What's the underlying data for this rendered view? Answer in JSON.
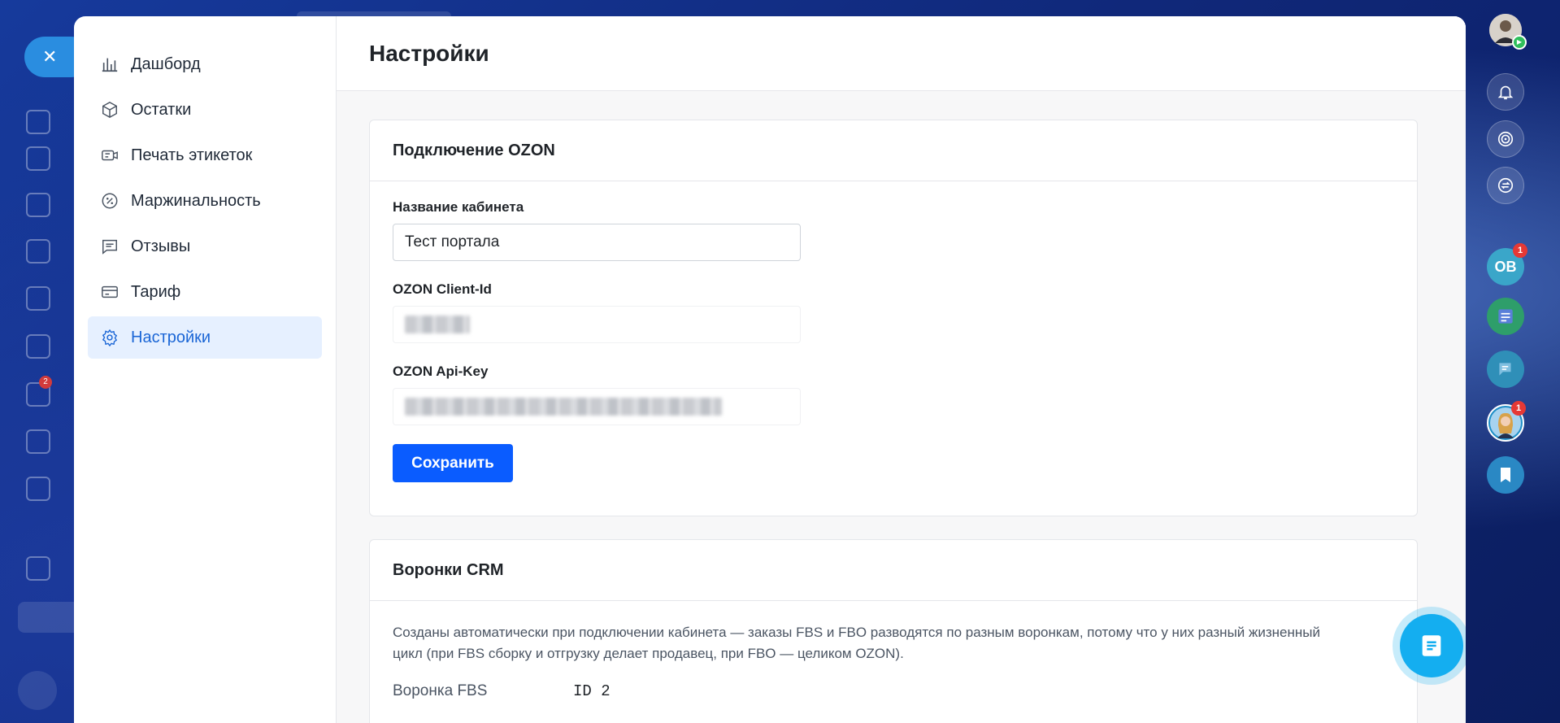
{
  "sidebar": {
    "items": [
      {
        "label": "Дашборд",
        "icon": "bar-chart-icon"
      },
      {
        "label": "Остатки",
        "icon": "box-icon"
      },
      {
        "label": "Печать этикеток",
        "icon": "label-icon"
      },
      {
        "label": "Маржинальность",
        "icon": "percent-icon"
      },
      {
        "label": "Отзывы",
        "icon": "comment-icon"
      },
      {
        "label": "Тариф",
        "icon": "card-icon"
      },
      {
        "label": "Настройки",
        "icon": "gear-icon",
        "active": true
      }
    ]
  },
  "main": {
    "title": "Настройки",
    "ozon_card": {
      "title": "Подключение OZON",
      "cabinet_label": "Название кабинета",
      "cabinet_value": "Тест портала",
      "client_id_label": "OZON Client-Id",
      "api_key_label": "OZON Api-Key",
      "save_label": "Сохранить"
    },
    "crm_card": {
      "title": "Воронки CRM",
      "description": "Созданы автоматически при подключении кабинета — заказы FBS и FBO разводятся по разным воронкам, потому что у них разный жизненный цикл (при FBS сборку и отгрузку делает продавец, при FBO — целиком OZON).",
      "rows": [
        {
          "key": "Воронка FBS",
          "value": "ID 2"
        }
      ]
    }
  },
  "right_rail": {
    "ob_label": "OB",
    "ob_badge": "1",
    "avatar_badge": "1"
  },
  "behind": {
    "badge": "2"
  },
  "colors": {
    "accent": "#0a5cff",
    "active_bg": "#e6f0ff",
    "active_text": "#1b66d6",
    "fab": "#14aef0"
  }
}
